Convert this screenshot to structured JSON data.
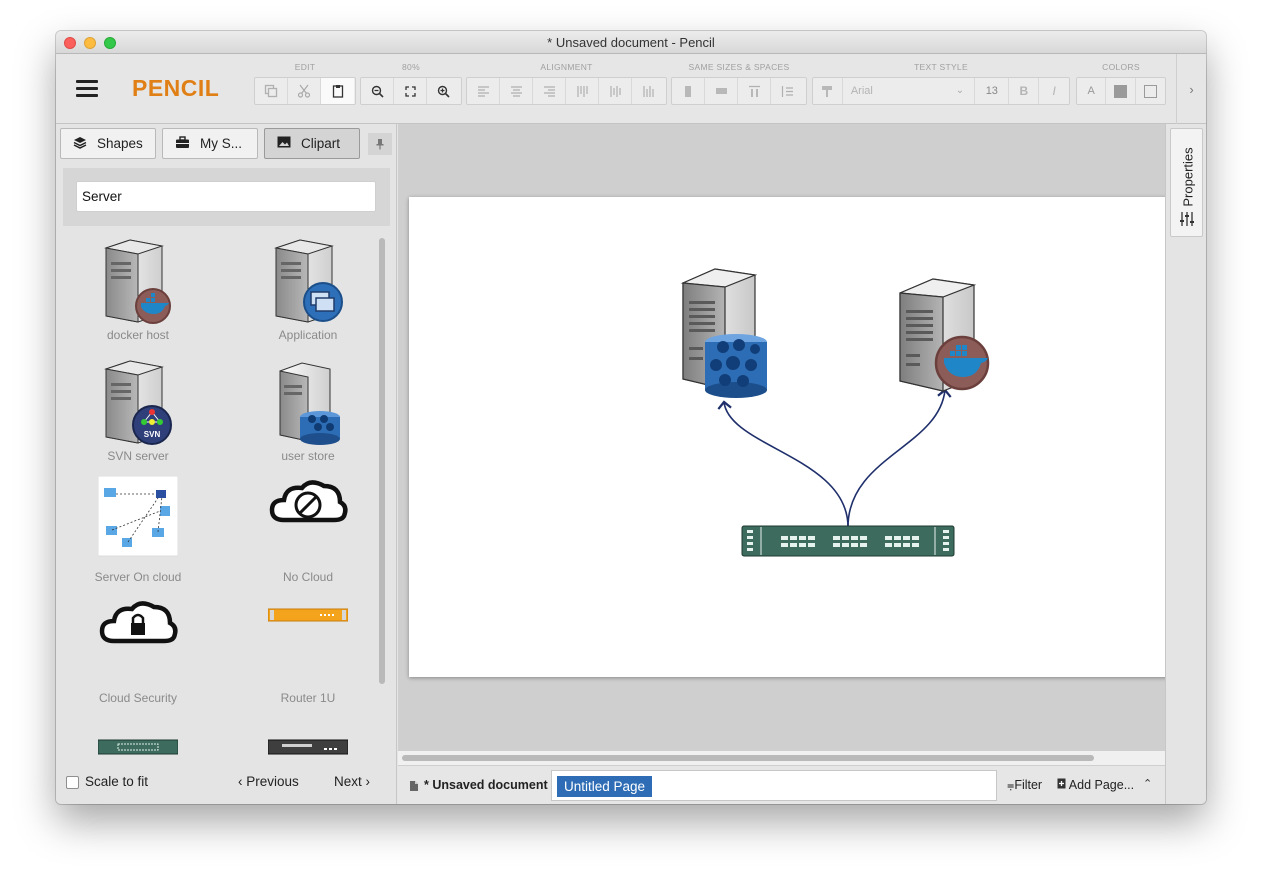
{
  "window": {
    "title": "* Unsaved document - Pencil"
  },
  "app": {
    "logo": "PENCIL"
  },
  "toolbar": {
    "groups": {
      "edit": "EDIT",
      "zoom": "80%",
      "alignment": "ALIGNMENT",
      "same_sizes": "SAME SIZES & SPACES",
      "text_style": "TEXT STYLE",
      "colors": "COLORS"
    },
    "font_family": "Arial",
    "font_size": "13",
    "bold_label": "B",
    "italic_label": "I",
    "text_color_label": "A"
  },
  "sidebar": {
    "tabs": [
      {
        "label": "Shapes",
        "icon": "layers-icon"
      },
      {
        "label": "My S...",
        "icon": "briefcase-icon"
      },
      {
        "label": "Clipart",
        "icon": "image-icon"
      }
    ],
    "search_value": "Server",
    "items": [
      {
        "label": "docker host"
      },
      {
        "label": "Application"
      },
      {
        "label": "SVN server"
      },
      {
        "label": "user store"
      },
      {
        "label": "Server On cloud"
      },
      {
        "label": "No Cloud"
      },
      {
        "label": "Cloud Security"
      },
      {
        "label": "Router 1U"
      }
    ],
    "footer": {
      "scale_label": "Scale to fit",
      "previous": "Previous",
      "next": "Next"
    }
  },
  "properties": {
    "label": "Properties"
  },
  "bottombar": {
    "document": "* Unsaved document",
    "page_tab": "Untitled Page",
    "filter": "Filter",
    "add_page": "Add Page..."
  },
  "colors": {
    "accent": "#2e6db5",
    "logo": "#e07f15",
    "switch_green": "#3d6b5d",
    "connector": "#1f2f6b"
  }
}
